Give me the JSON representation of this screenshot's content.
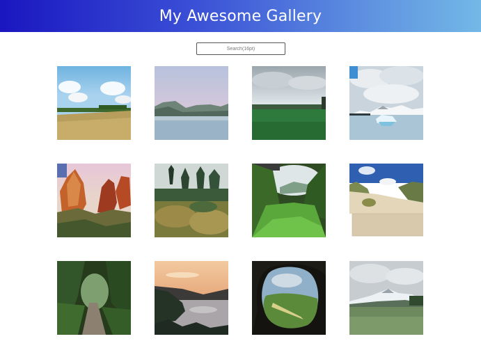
{
  "header": {
    "title": "My Awesome Gallery"
  },
  "search": {
    "placeholder": "Search(16pt)"
  },
  "gallery": {
    "images": [
      "field-with-sky-image",
      "lake-with-mountains-image",
      "green-meadow-image",
      "iceberg-lake-image",
      "canyon-rocks-image",
      "shrubland-image",
      "green-valley-image",
      "beach-dunes-image",
      "forest-path-image",
      "sunset-coast-image",
      "cave-view-image",
      "snowy-mountain-meadow-image"
    ]
  },
  "colors": {
    "header_gradient_start": "#1a16c0",
    "header_gradient_end": "#73b8e6",
    "background": "#ffffff"
  }
}
